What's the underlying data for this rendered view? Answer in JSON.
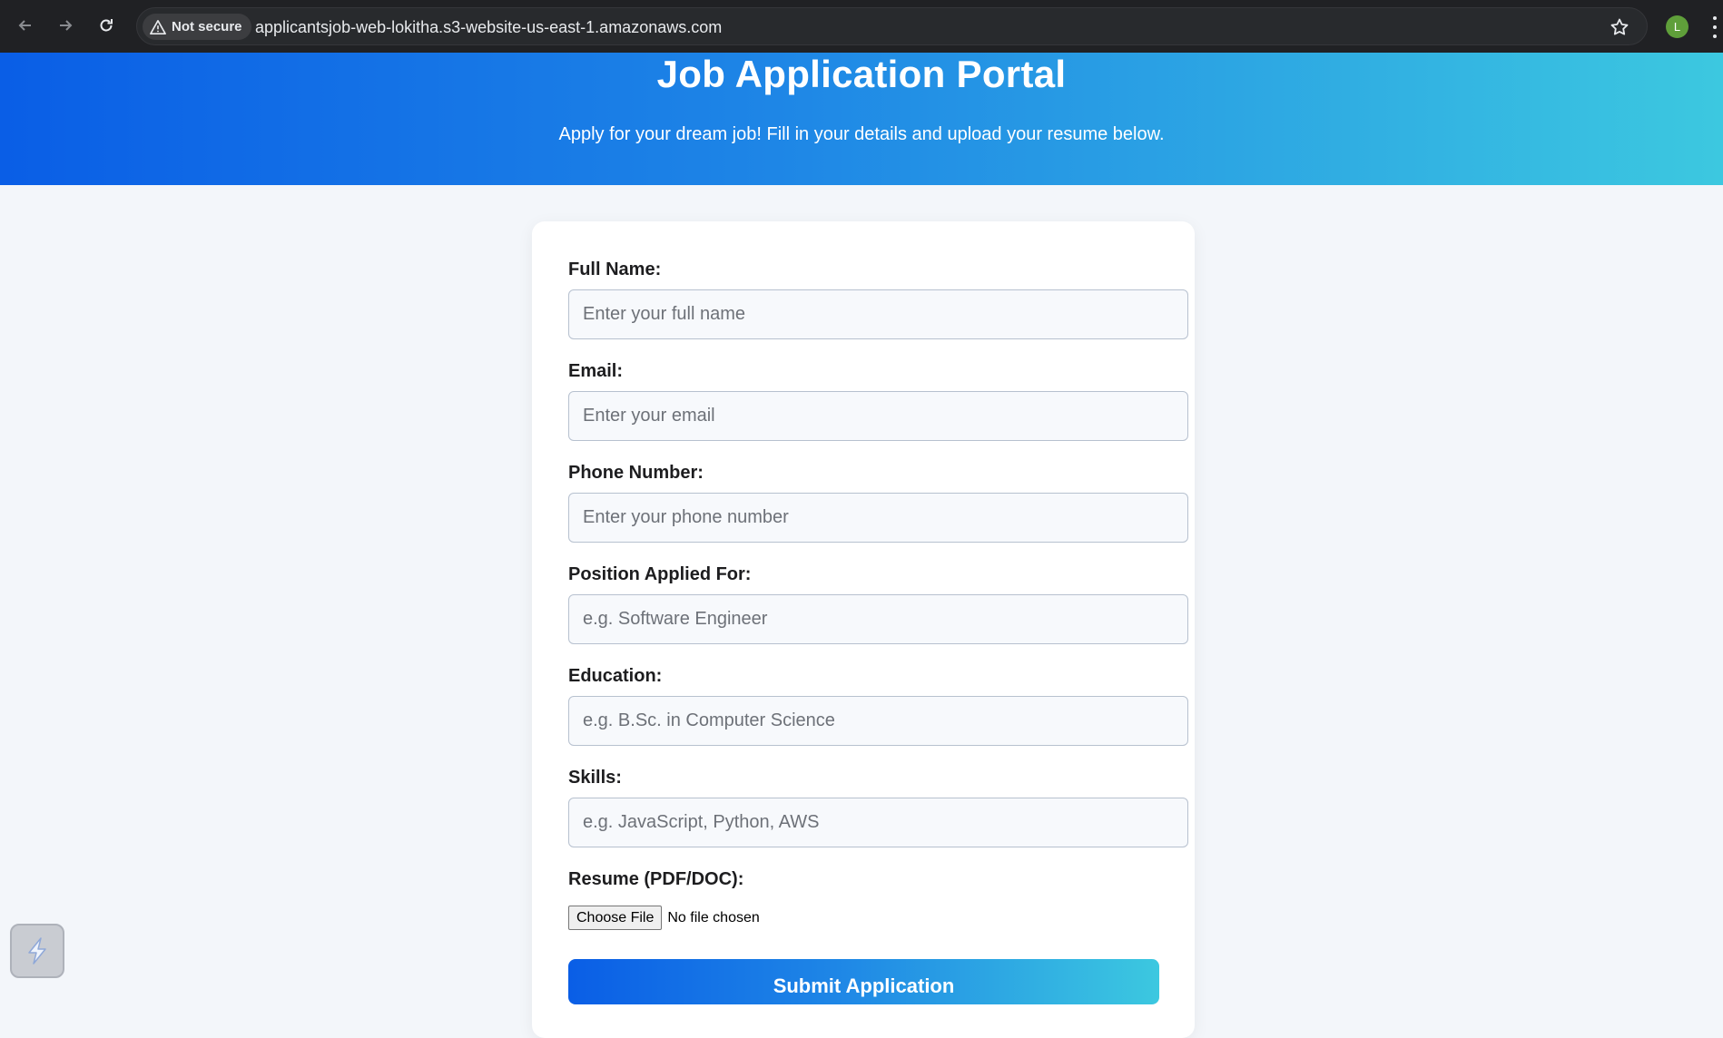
{
  "browser": {
    "security_label": "Not secure",
    "url": "applicantsjob-web-lokitha.s3-website-us-east-1.amazonaws.com",
    "profile_initial": "L",
    "icons": [
      "back-arrow-icon",
      "forward-arrow-icon",
      "reload-icon",
      "warning-icon",
      "star-icon",
      "menu-kebab-icon"
    ]
  },
  "header": {
    "title": "Job Application Portal",
    "subtitle": "Apply for your dream job! Fill in your details and upload your resume below."
  },
  "form": {
    "fields": [
      {
        "label": "Full Name:",
        "placeholder": "Enter your full name",
        "value": ""
      },
      {
        "label": "Email:",
        "placeholder": "Enter your email",
        "value": ""
      },
      {
        "label": "Phone Number:",
        "placeholder": "Enter your phone number",
        "value": ""
      },
      {
        "label": "Position Applied For:",
        "placeholder": "e.g. Software Engineer",
        "value": ""
      },
      {
        "label": "Education:",
        "placeholder": "e.g. B.Sc. in Computer Science",
        "value": ""
      },
      {
        "label": "Skills:",
        "placeholder": "e.g. JavaScript, Python, AWS",
        "value": ""
      }
    ],
    "resume": {
      "label": "Resume (PDF/DOC):",
      "button_label": "Choose File",
      "status": "No file chosen"
    },
    "submit_label": "Submit Application"
  },
  "colors": {
    "gradient_start": "#0a5ee6",
    "gradient_end": "#3cc8e0",
    "page_bg": "#f3f6fa"
  }
}
